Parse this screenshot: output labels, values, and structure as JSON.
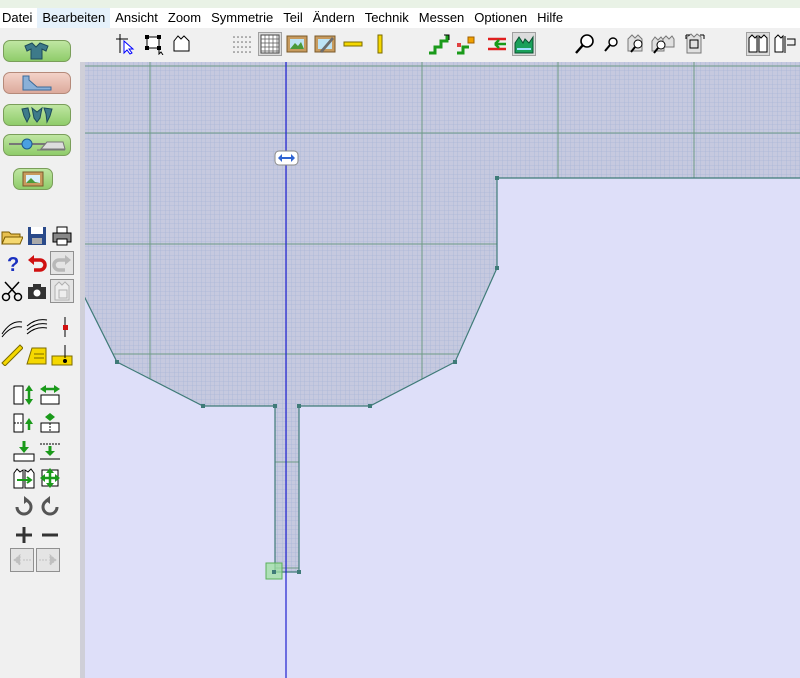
{
  "menu": {
    "items": [
      "Datei",
      "Bearbeiten",
      "Ansicht",
      "Zoom",
      "Symmetrie",
      "Teil",
      "Ändern",
      "Technik",
      "Messen",
      "Optionen",
      "Hilfe"
    ],
    "active_index": 1
  },
  "toolbar": {
    "icons": [
      "select-arrow-icon",
      "select-point-icon",
      "select-piece-icon",
      "dot-grid-icon",
      "square-grid-icon",
      "picture-icon",
      "picture-edit-icon",
      "horizontal-ruler-icon",
      "vertical-ruler-icon",
      "grade-stairs-icon",
      "grade-points-icon",
      "grade-arrows-icon",
      "grade-size-icon",
      "zoom-large-icon",
      "zoom-small-icon",
      "zoom-piece-icon",
      "zoom-pieces-icon",
      "zoom-fit-icon",
      "layout-symmetric-icon",
      "layout-split-icon"
    ]
  },
  "sidebar": {
    "modes": [
      "garment-mode-icon",
      "pattern-mode-icon",
      "pieces-mode-icon",
      "measure-mode-icon",
      "photo-mode-icon"
    ],
    "active_mode": "pattern-mode-icon",
    "tools": [
      "open-folder-icon",
      "save-disk-icon",
      "print-icon",
      "help-icon",
      "undo-icon",
      "redo-icon",
      "cut-scissors-icon",
      "camera-icon",
      "paste-piece-icon",
      "curve-lines-icon",
      "parallel-curves-icon",
      "vertical-point-icon",
      "ruler-icon",
      "tape-measure-icon",
      "notch-tool-icon",
      "move-vertical-icon",
      "move-horizontal-icon",
      "extend-vertical-icon",
      "extend-horizontal-icon",
      "drop-point-icon",
      "slide-point-icon",
      "mirror-piece-icon",
      "move-cross-icon",
      "rotate-right-icon",
      "rotate-left-icon",
      "add-point-icon",
      "remove-point-icon",
      "step-back-icon",
      "step-forward-icon"
    ]
  },
  "colors": {
    "workspace": "#dedff9",
    "grid_fill": "#c6c9df",
    "grid_minor": "#9fb0d6",
    "grid_major": "#6e9a86",
    "outline": "#3f7b78",
    "axis": "#2020d0",
    "handle": "#2f63d2",
    "endpoint": "#9ee0a0"
  }
}
